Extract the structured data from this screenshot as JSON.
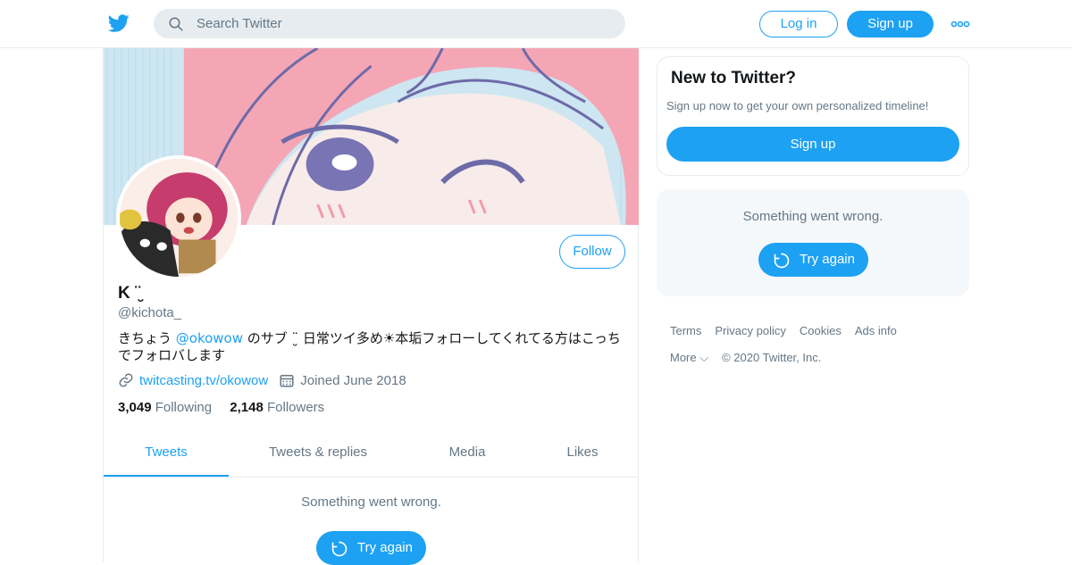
{
  "colors": {
    "accent": "#1da1f2",
    "muted": "#657786",
    "border": "#e6ecf0",
    "text": "#14171a"
  },
  "topbar": {
    "search_placeholder": "Search Twitter",
    "login_label": "Log in",
    "signup_label": "Sign up",
    "logo_icon": "twitter-bird-icon",
    "more_icon": "more-dots-icon"
  },
  "profile": {
    "display_name": "K ¨̮",
    "handle": "@kichota_",
    "follow_label": "Follow",
    "bio_prefix": "きちょう ",
    "bio_mention": "@okowow",
    "bio_suffix": " のサブ ¨̮ 日常ツイ多め☀本垢フォローしてくれてる方はこっちでフォロバします",
    "website": "twitcasting.tv/okowow",
    "joined": "Joined June 2018",
    "following_count": "3,049",
    "following_label": "Following",
    "followers_count": "2,148",
    "followers_label": "Followers"
  },
  "tabs": [
    {
      "label": "Tweets",
      "active": true
    },
    {
      "label": "Tweets & replies",
      "active": false
    },
    {
      "label": "Media",
      "active": false
    },
    {
      "label": "Likes",
      "active": false
    }
  ],
  "timeline": {
    "error_message": "Something went wrong.",
    "retry_label": "Try again"
  },
  "sidebar": {
    "new_title": "New to Twitter?",
    "new_desc": "Sign up now to get your own personalized timeline!",
    "signup_label": "Sign up",
    "error_message": "Something went wrong.",
    "retry_label": "Try again"
  },
  "footer": {
    "terms": "Terms",
    "privacy": "Privacy policy",
    "cookies": "Cookies",
    "ads_info": "Ads info",
    "more": "More",
    "copyright": "© 2020 Twitter, Inc."
  }
}
